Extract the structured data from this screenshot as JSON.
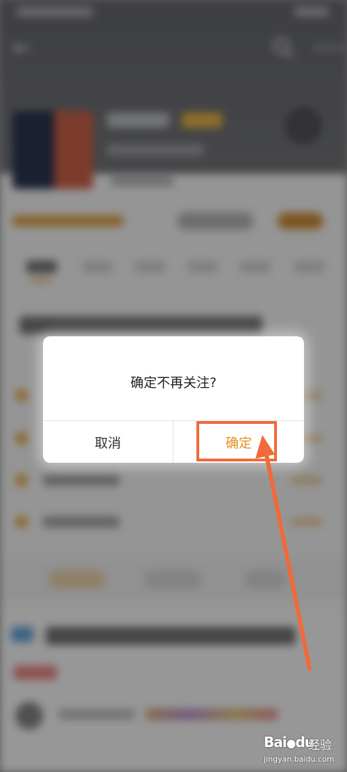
{
  "dialog": {
    "message": "确定不再关注?",
    "cancel_label": "取消",
    "confirm_label": "确定"
  },
  "colors": {
    "confirm_text": "#e2901e",
    "annotation": "#f06a3a",
    "overlay": "rgba(20,20,20,0.42)"
  },
  "icons": {
    "back": "back-arrow-icon",
    "search": "search-icon",
    "more": "more-icon"
  },
  "watermark": {
    "brand": "Bai",
    "brand_suffix": "du",
    "product": "经验",
    "url": "jingyan.baidu.com"
  }
}
